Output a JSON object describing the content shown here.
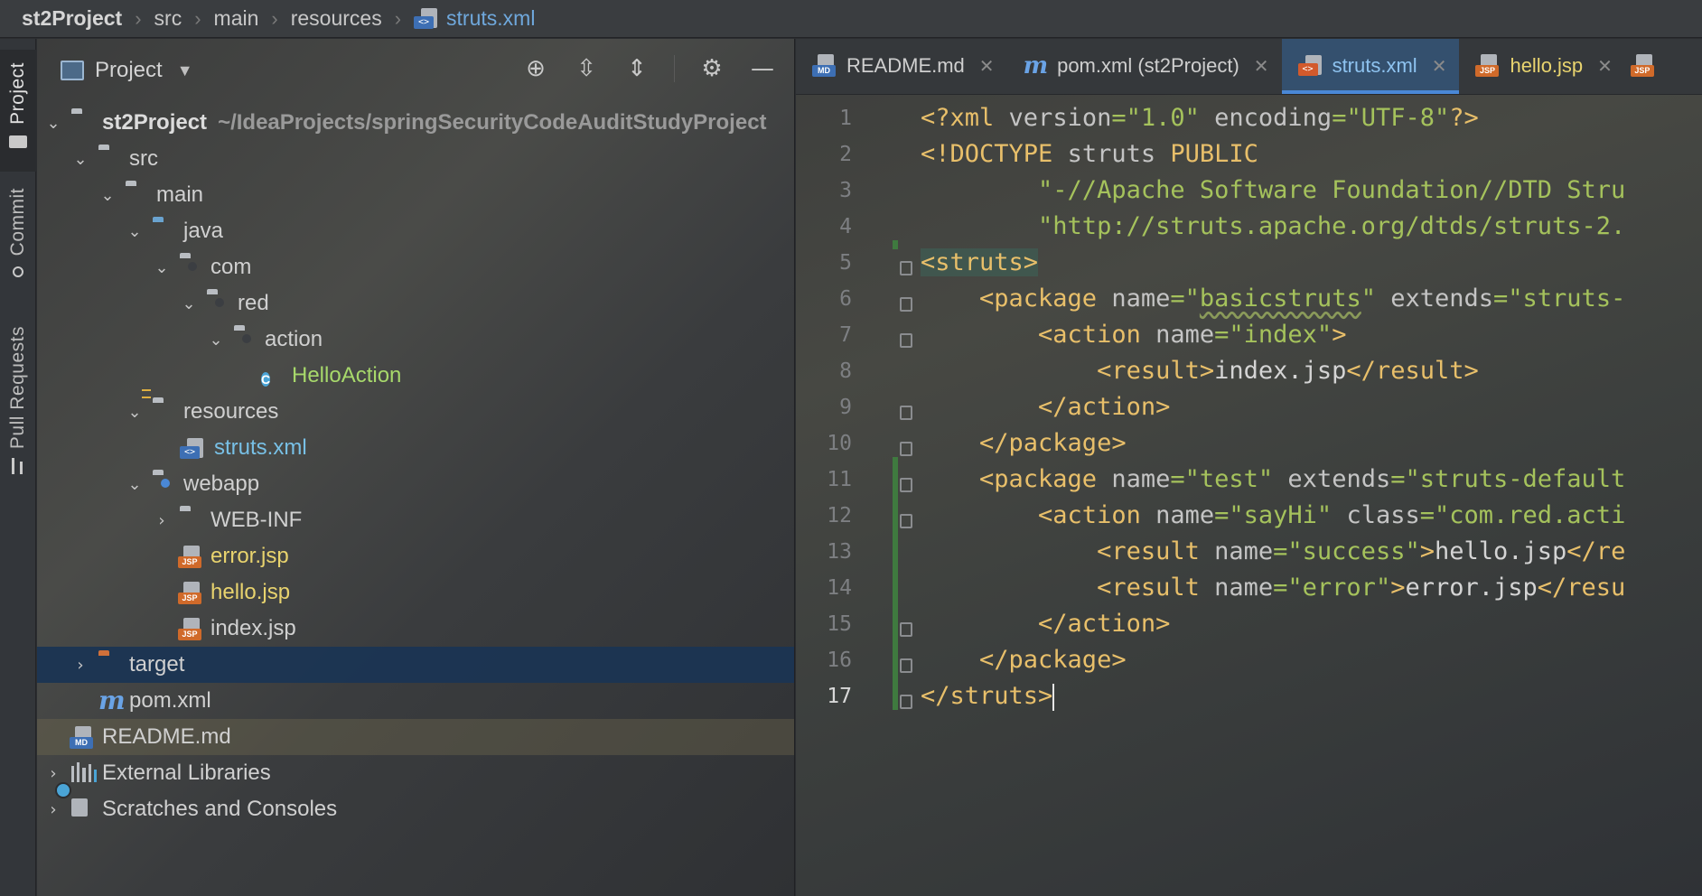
{
  "breadcrumb": {
    "items": [
      "st2Project",
      "src",
      "main",
      "resources"
    ],
    "file": "struts.xml"
  },
  "tool_strip": {
    "project": "Project",
    "commit": "Commit",
    "pull_requests": "Pull Requests"
  },
  "project_panel": {
    "title": "Project",
    "tree": [
      {
        "label": "st2Project",
        "extra": "~/IdeaProjects/springSecurityCodeAuditStudyProject"
      },
      {
        "label": "src"
      },
      {
        "label": "main"
      },
      {
        "label": "java"
      },
      {
        "label": "com"
      },
      {
        "label": "red"
      },
      {
        "label": "action"
      },
      {
        "label": "HelloAction"
      },
      {
        "label": "resources"
      },
      {
        "label": "struts.xml"
      },
      {
        "label": "webapp"
      },
      {
        "label": "WEB-INF"
      },
      {
        "label": "error.jsp"
      },
      {
        "label": "hello.jsp"
      },
      {
        "label": "index.jsp"
      },
      {
        "label": "target"
      },
      {
        "label": "pom.xml"
      },
      {
        "label": "README.md"
      },
      {
        "label": "External Libraries"
      },
      {
        "label": "Scratches and Consoles"
      }
    ]
  },
  "tabs": [
    {
      "label": "README.md"
    },
    {
      "label": "pom.xml (st2Project)"
    },
    {
      "label": "struts.xml"
    },
    {
      "label": "hello.jsp"
    }
  ],
  "editor": {
    "line_numbers": [
      "1",
      "2",
      "3",
      "4",
      "5",
      "6",
      "7",
      "8",
      "9",
      "10",
      "11",
      "12",
      "13",
      "14",
      "15",
      "16",
      "17"
    ],
    "current_line": "17",
    "code": {
      "l1": {
        "t1": "<?xml ",
        "t2": "version",
        "t3": "=",
        "t4": "\"1.0\"",
        "t5": " encoding",
        "t6": "=",
        "t7": "\"UTF-8\"",
        "t8": "?>"
      },
      "l2": {
        "t1": "<!DOCTYPE ",
        "t2": "struts ",
        "t3": "PUBLIC"
      },
      "l3": {
        "t1": "        \"-//Apache Software Foundation//DTD Stru"
      },
      "l4": {
        "t1": "        \"http://struts.apache.org/dtds/struts-2."
      },
      "l5": {
        "t1": "<struts>"
      },
      "l6": {
        "t1": "    <package ",
        "t2": "name",
        "t3": "=",
        "t4": "\"",
        "t5": "basicstruts",
        "t6": "\"",
        "t7": " extends",
        "t8": "=",
        "t9": "\"struts-"
      },
      "l7": {
        "t1": "        <action ",
        "t2": "name",
        "t3": "=",
        "t4": "\"index\"",
        "t5": ">"
      },
      "l8": {
        "t1": "            <result>",
        "t2": "index.jsp",
        "t3": "</result>"
      },
      "l9": {
        "t1": "        </action>"
      },
      "l10": {
        "t1": "    </package>"
      },
      "l11": {
        "t1": "    <package ",
        "t2": "name",
        "t3": "=",
        "t4": "\"test\"",
        "t5": " extends",
        "t6": "=",
        "t7": "\"struts-default"
      },
      "l12": {
        "t1": "        <action ",
        "t2": "name",
        "t3": "=",
        "t4": "\"sayHi\"",
        "t5": " class",
        "t6": "=",
        "t7": "\"com.red.acti"
      },
      "l13": {
        "t1": "            <result ",
        "t2": "name",
        "t3": "=",
        "t4": "\"success\"",
        "t5": ">",
        "t6": "hello.jsp",
        "t7": "</re"
      },
      "l14": {
        "t1": "            <result ",
        "t2": "name",
        "t3": "=",
        "t4": "\"error\"",
        "t5": ">",
        "t6": "error.jsp",
        "t7": "</resu"
      },
      "l15": {
        "t1": "        </action>"
      },
      "l16": {
        "t1": "    </package>"
      },
      "l17": {
        "t1": "</struts>"
      }
    }
  },
  "colors": {
    "tag": "#e8bf6a",
    "string": "#a5c25c",
    "active_tab": "#34506e",
    "selection": "#1a3454"
  }
}
